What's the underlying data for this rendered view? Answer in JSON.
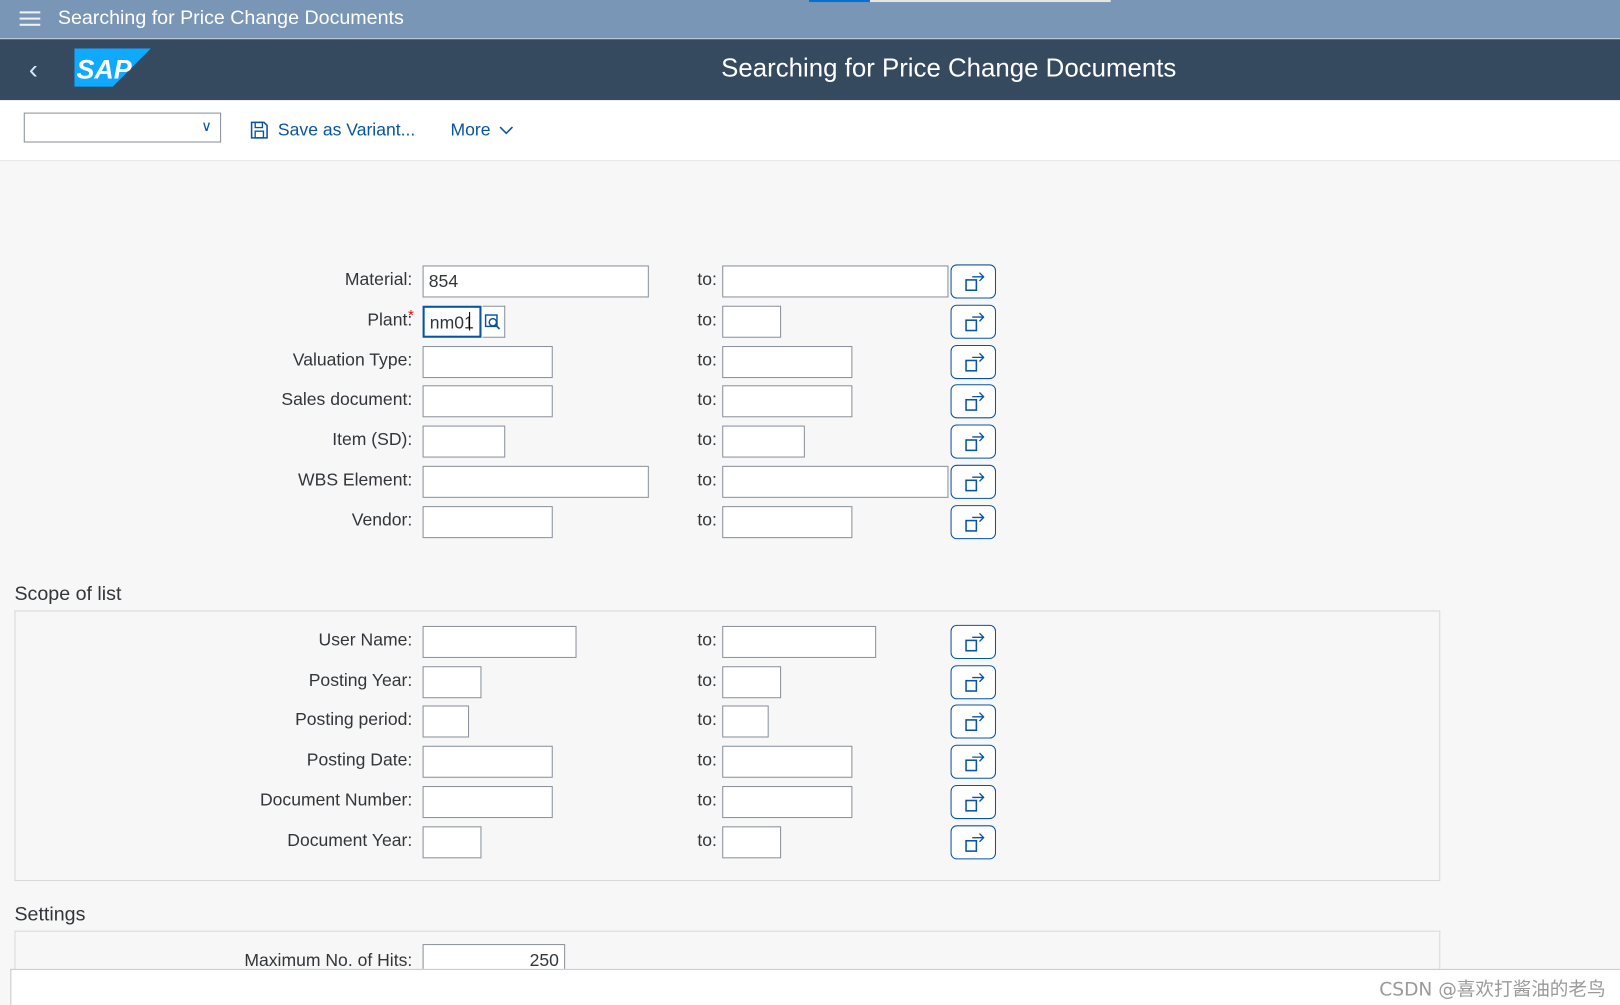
{
  "shell": {
    "title": "Searching for Price Change Documents",
    "menu_icon": "hamburger-menu-icon"
  },
  "header": {
    "title": "Searching for Price Change Documents",
    "back_icon": "chevron-left-icon",
    "logo_text": "SAP",
    "brand_color": "#354a5f",
    "logo_color": "#0faaff"
  },
  "toolbar": {
    "variant_value": "",
    "save_variant_label": "Save as Variant...",
    "more_label": "More"
  },
  "to_label": "to:",
  "main_fields": [
    {
      "label": "Material:",
      "from": "854",
      "to": ""
    },
    {
      "label": "Plant:",
      "from": "nm01",
      "to": "",
      "required": true
    },
    {
      "label": "Valuation Type:",
      "from": "",
      "to": ""
    },
    {
      "label": "Sales document:",
      "from": "",
      "to": ""
    },
    {
      "label": "Item (SD):",
      "from": "",
      "to": ""
    },
    {
      "label": "WBS Element:",
      "from": "",
      "to": ""
    },
    {
      "label": "Vendor:",
      "from": "",
      "to": ""
    }
  ],
  "scope": {
    "title": "Scope of list",
    "fields": [
      {
        "label": "User Name:",
        "from": "",
        "to": ""
      },
      {
        "label": "Posting Year:",
        "from": "",
        "to": ""
      },
      {
        "label": "Posting period:",
        "from": "",
        "to": ""
      },
      {
        "label": "Posting Date:",
        "from": "",
        "to": ""
      },
      {
        "label": "Document Number:",
        "from": "",
        "to": ""
      },
      {
        "label": "Document Year:",
        "from": "",
        "to": ""
      }
    ]
  },
  "settings": {
    "title": "Settings",
    "max_hits_label": "Maximum No. of Hits:",
    "max_hits_value": "250"
  },
  "watermark": "CSDN @喜欢打酱油的老鸟"
}
